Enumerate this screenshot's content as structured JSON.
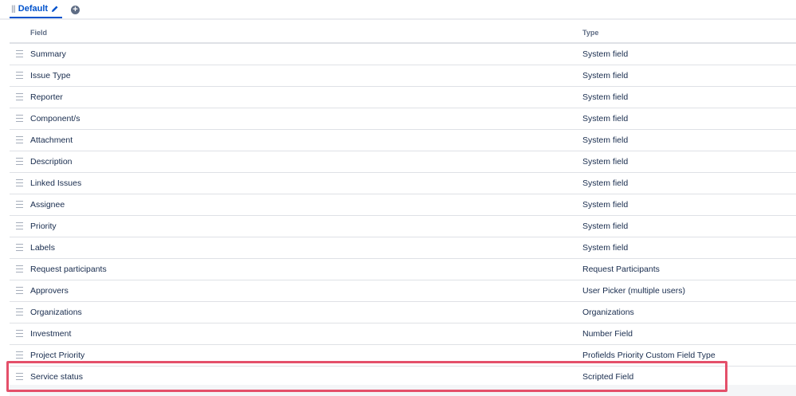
{
  "tabs": {
    "active_label": "Default",
    "add_label": "+"
  },
  "table": {
    "headers": {
      "field": "Field",
      "type": "Type"
    },
    "rows": [
      {
        "field": "Summary",
        "type": "System field"
      },
      {
        "field": "Issue Type",
        "type": "System field"
      },
      {
        "field": "Reporter",
        "type": "System field"
      },
      {
        "field": "Component/s",
        "type": "System field"
      },
      {
        "field": "Attachment",
        "type": "System field"
      },
      {
        "field": "Description",
        "type": "System field"
      },
      {
        "field": "Linked Issues",
        "type": "System field"
      },
      {
        "field": "Assignee",
        "type": "System field"
      },
      {
        "field": "Priority",
        "type": "System field"
      },
      {
        "field": "Labels",
        "type": "System field"
      },
      {
        "field": "Request participants",
        "type": "Request Participants"
      },
      {
        "field": "Approvers",
        "type": "User Picker (multiple users)"
      },
      {
        "field": "Organizations",
        "type": "Organizations"
      },
      {
        "field": "Investment",
        "type": "Number Field"
      },
      {
        "field": "Project Priority",
        "type": "Profields Priority Custom Field Type"
      },
      {
        "field": "Service status",
        "type": "Scripted Field"
      }
    ]
  },
  "colors": {
    "accent": "#0052cc",
    "highlight": "#e4506a"
  }
}
